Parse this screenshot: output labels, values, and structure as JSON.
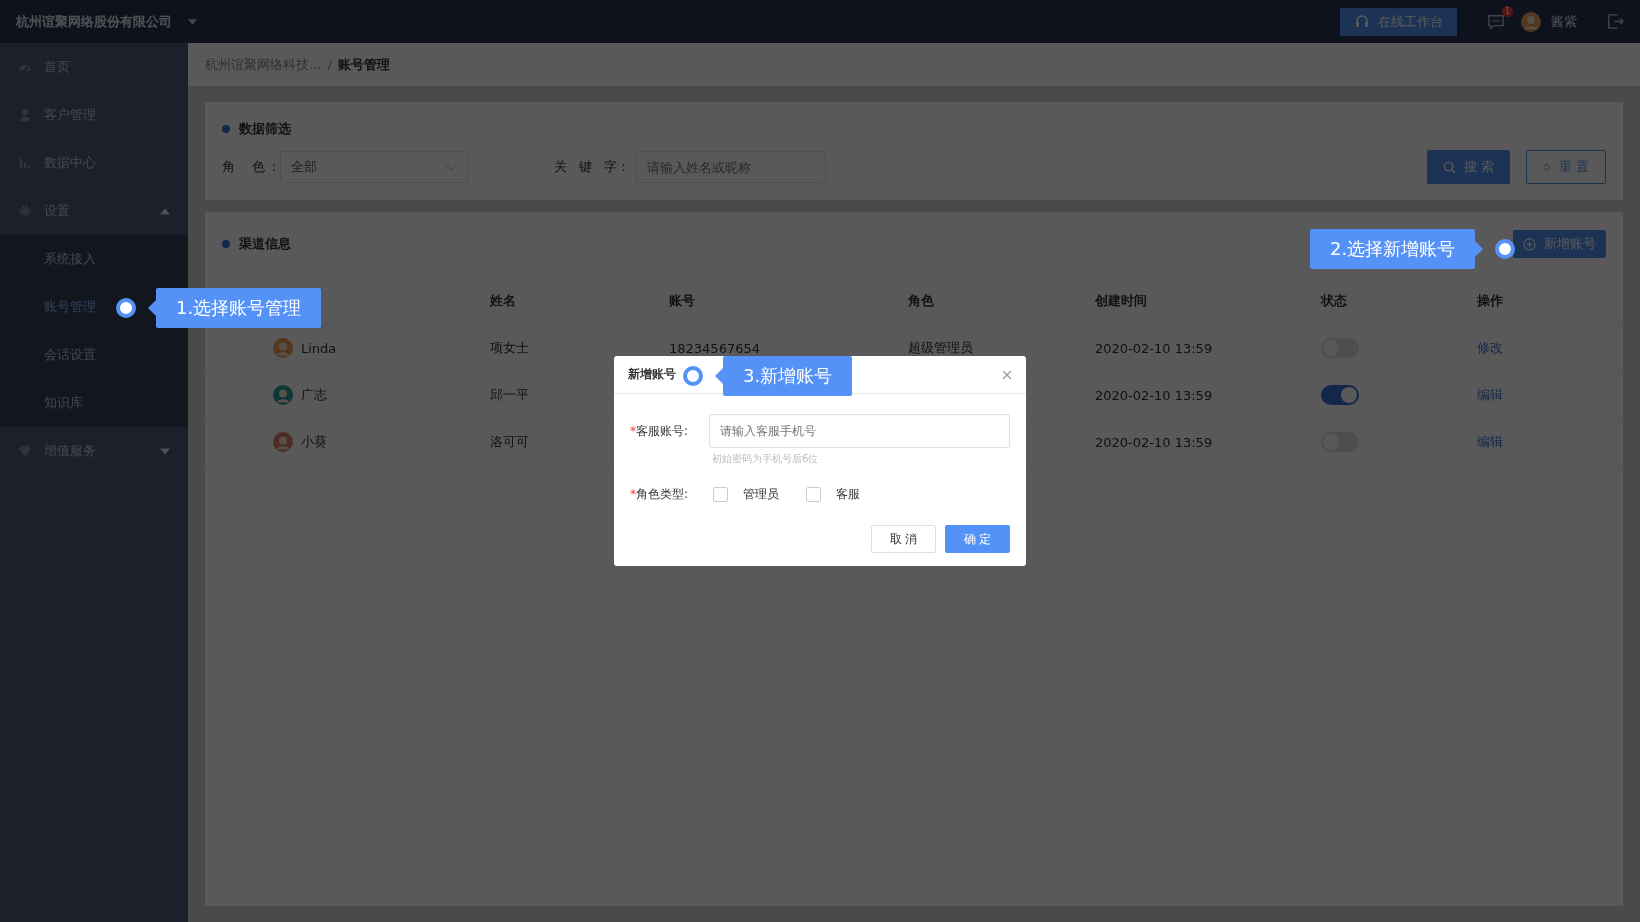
{
  "topbar": {
    "company": "杭州谊聚网络股份有限公司",
    "workbench_button": "在线工作台",
    "notification_badge": "1",
    "username": "酱紫"
  },
  "sidebar": {
    "items": [
      {
        "label": "首页",
        "selected": false
      },
      {
        "label": "客户管理",
        "selected": false
      },
      {
        "label": "数据中心",
        "selected": false
      },
      {
        "label": "设置",
        "selected": false,
        "expanded": true,
        "children": [
          {
            "label": "系统接入",
            "selected": false
          },
          {
            "label": "账号管理",
            "selected": true
          },
          {
            "label": "会话设置",
            "selected": false
          },
          {
            "label": "知识库",
            "selected": false
          }
        ]
      },
      {
        "label": "增值服务",
        "selected": false,
        "expanded": false
      }
    ]
  },
  "breadcrumb": [
    {
      "label": "杭州谊聚网络科技...",
      "current": false
    },
    {
      "label": "账号管理",
      "current": true
    }
  ],
  "breadcrumb_separator": "/",
  "filter": {
    "title": "数据筛选",
    "role_label": "角 色:",
    "role_value": "全部",
    "keyword_label": "关 键 字:",
    "keyword_placeholder": "请输入姓名或昵称",
    "search_button": "搜 索",
    "reset_button": "重 置"
  },
  "table": {
    "title": "渠道信息",
    "add_button": "新增账号",
    "columns": [
      "姓名",
      "账号",
      "角色",
      "创建时间",
      "状态",
      "操作"
    ],
    "rows": [
      {
        "nickname": "Linda",
        "name": "项女士",
        "account": "18234567654",
        "role": "超级管理员",
        "created": "2020-02-10 13:59",
        "on": false,
        "action": "修改"
      },
      {
        "nickname": "广志",
        "name": "邱一平",
        "created": "2020-02-10 13:59",
        "on": true,
        "action": "编辑"
      },
      {
        "nickname": "小葵",
        "name": "洛可可",
        "created": "2020-02-10 13:59",
        "on": false,
        "action": "编辑"
      }
    ]
  },
  "dialog": {
    "title": "新增账号",
    "required_mark": "*",
    "account_label": "客服账号:",
    "account_required": true,
    "account_placeholder": "请输入客服手机号",
    "account_hint": "初始密码为手机号后6位",
    "role_label": "角色类型:",
    "role_required": true,
    "role_options": [
      {
        "label": "管理员",
        "checked": false
      },
      {
        "label": "客服",
        "checked": false
      }
    ],
    "cancel_button": "取 消",
    "confirm_button": "确 定"
  },
  "annotations": [
    {
      "text": "1.选择账号管理"
    },
    {
      "text": "2.选择新增账号"
    },
    {
      "text": "3.新增账号"
    }
  ]
}
